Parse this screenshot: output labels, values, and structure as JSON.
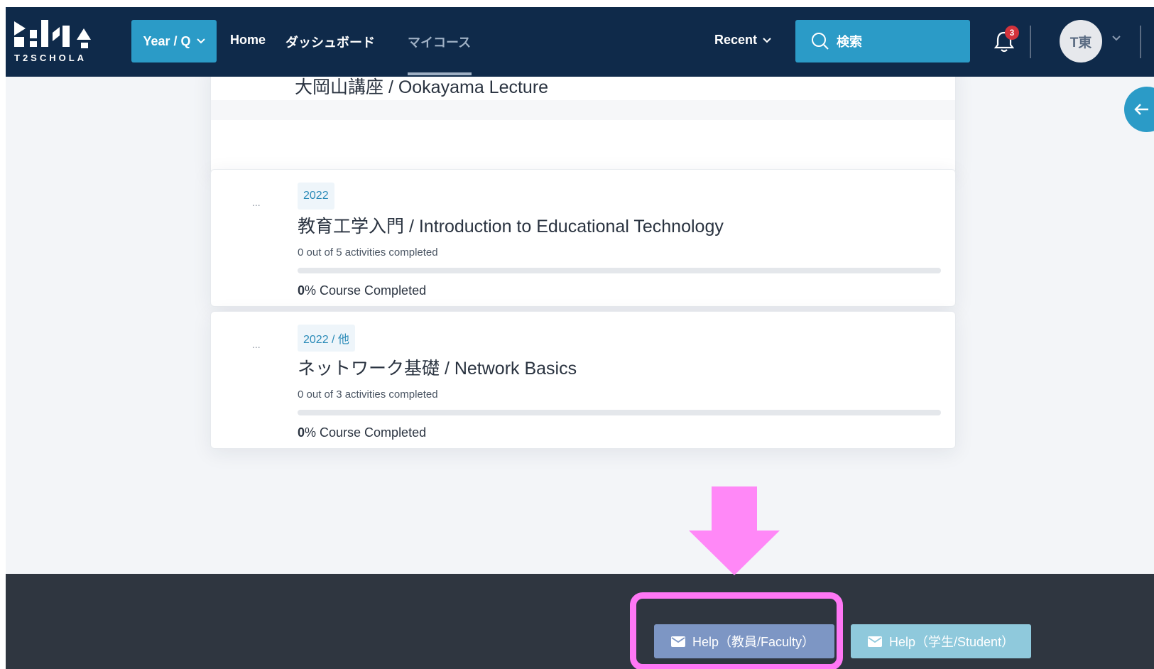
{
  "navbar": {
    "logo_text": "T2SCHOLA",
    "year_button": "Year / Q",
    "links": [
      "Home",
      "ダッシュボード",
      "マイコース"
    ],
    "recent": "Recent",
    "search_label": "検索",
    "notification_count": "3",
    "avatar_initials": "T東"
  },
  "courses": {
    "top_card_title": "大岡山講座 / Ookayama Lecture",
    "items": [
      {
        "dots": "...",
        "year": "2022",
        "title": "教育工学入門 / Introduction to Educational Technology",
        "activities": "0 out of 5 activities completed",
        "progress_fraction": 0,
        "percent": "0",
        "completed_suffix": "% Course Completed"
      },
      {
        "dots": "...",
        "year": "2022 / 他",
        "title": "ネットワーク基礎 / Network Basics",
        "activities": "0 out of 3 activities completed",
        "progress_fraction": 0,
        "percent": "0",
        "completed_suffix": "% Course Completed"
      }
    ]
  },
  "footer": {
    "help_faculty": "Help（教員/Faculty）",
    "help_student": "Help（学生/Student）"
  },
  "colors": {
    "navbar": "#0f2a4a",
    "accent": "#2b9bc7",
    "annotation": "#ff77f5"
  }
}
